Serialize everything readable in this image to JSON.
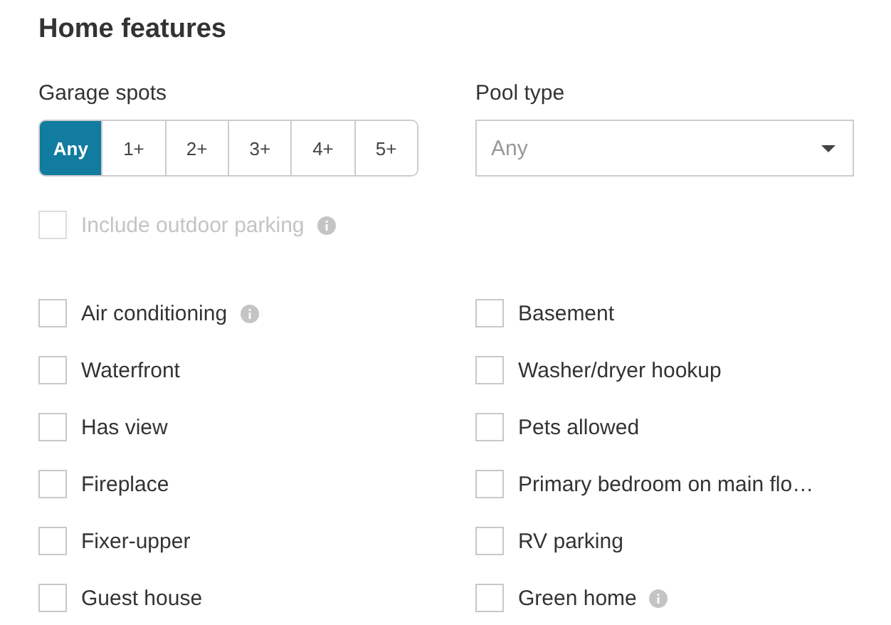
{
  "title": "Home features",
  "garage": {
    "label": "Garage spots",
    "options": [
      {
        "label": "Any",
        "selected": true
      },
      {
        "label": "1+",
        "selected": false
      },
      {
        "label": "2+",
        "selected": false
      },
      {
        "label": "3+",
        "selected": false
      },
      {
        "label": "4+",
        "selected": false
      },
      {
        "label": "5+",
        "selected": false
      }
    ]
  },
  "pool": {
    "label": "Pool type",
    "value": "Any"
  },
  "outdoor_parking": {
    "label": "Include outdoor parking",
    "checked": false,
    "disabled": true,
    "info": true
  },
  "features": [
    {
      "label": "Air conditioning",
      "checked": false,
      "info": true
    },
    {
      "label": "Basement",
      "checked": false,
      "info": false
    },
    {
      "label": "Waterfront",
      "checked": false,
      "info": false
    },
    {
      "label": "Washer/dryer hookup",
      "checked": false,
      "info": false
    },
    {
      "label": "Has view",
      "checked": false,
      "info": false
    },
    {
      "label": "Pets allowed",
      "checked": false,
      "info": false
    },
    {
      "label": "Fireplace",
      "checked": false,
      "info": false
    },
    {
      "label": "Primary bedroom on main flo…",
      "checked": false,
      "info": false
    },
    {
      "label": "Fixer-upper",
      "checked": false,
      "info": false
    },
    {
      "label": "RV parking",
      "checked": false,
      "info": false
    },
    {
      "label": "Guest house",
      "checked": false,
      "info": false
    },
    {
      "label": "Green home",
      "checked": false,
      "info": true
    }
  ]
}
